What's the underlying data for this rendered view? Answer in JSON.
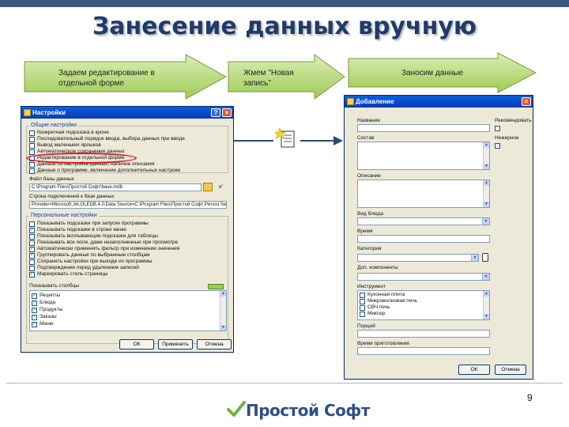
{
  "slide": {
    "title": "Занесение данных вручную",
    "page_number": "9"
  },
  "steps": [
    {
      "text": "Задаем редактирование в отдельной форме"
    },
    {
      "text": "Жмем \"Новая запись\""
    },
    {
      "text": "Заносим данные"
    }
  ],
  "settings_window": {
    "title": "Настройки",
    "general_group": "Общие настройки",
    "general_items": [
      {
        "label": "Конкретная подсказка в кроне",
        "checked": false
      },
      {
        "label": "Последовательный порядок ввода, выбора данных при вводе",
        "checked": false
      },
      {
        "label": "Вывод маленьких ярлыков",
        "checked": false
      },
      {
        "label": "Автоматическое сохранение данных",
        "checked": false
      },
      {
        "label": "Редактирование в отдельной форме",
        "checked": false
      },
      {
        "label": "Данные по настройке данных, наличие описания",
        "checked": false
      },
      {
        "label": "Данные о программе, включение дополнительных настроек",
        "checked": false
      }
    ],
    "file_label": "Файл базы данных",
    "file_value": "C:\\Program Files\\Простой Софт\\base.mdb",
    "conn_label": "Строка подключения к базе данных",
    "conn_value": "Provider=Microsoft.Jet.OLEDB.4.0;Data Source=C:\\Program Files\\Простой Софт;Persist Security Info=False",
    "personal_group": "Персональные настройки",
    "personal_items": [
      {
        "label": "Показывать подсказки при запуске программы",
        "checked": false
      },
      {
        "label": "Показывать подсказки в строке меню",
        "checked": true
      },
      {
        "label": "Показывать всплывающие подсказки для таблицы",
        "checked": false
      },
      {
        "label": "Показывать все поля, даже незаполненные при просмотре",
        "checked": false
      },
      {
        "label": "Автоматически применять фильтр при изменении значения",
        "checked": true
      },
      {
        "label": "Группировать данные по выбранным столбцам",
        "checked": true
      },
      {
        "label": "Сохранять настройки при выходе из программы",
        "checked": false
      },
      {
        "label": "Подтверждение перед удалением записей",
        "checked": false
      },
      {
        "label": "Маркировать стиль страницы",
        "checked": true
      }
    ],
    "list_label": "Показывать столбцы",
    "list_items": [
      {
        "label": "Рецепты",
        "checked": true
      },
      {
        "label": "Блюда",
        "checked": true
      },
      {
        "label": "Продукты",
        "checked": true
      },
      {
        "label": "Заказы",
        "checked": true
      },
      {
        "label": "Меню",
        "checked": true
      }
    ],
    "ok_label": "ОК",
    "apply_label": "Применить",
    "cancel_label": "Отмена"
  },
  "new_record_icon": "new-record-icon",
  "add_window": {
    "title": "Добавление",
    "name_label": "Название",
    "recommend_label": "Рекомендовать",
    "composition_label": "Состав",
    "nonfat_label": "Нежирное",
    "description_label": "Описание",
    "base_label": "Вид блюда",
    "time_label": "Время",
    "category_label": "Категория",
    "extra_label": "Доп. компоненты",
    "tools_label": "Инструмент",
    "tools_items": [
      {
        "label": "Кухонная плита",
        "checked": false
      },
      {
        "label": "Микроволновая печь",
        "checked": false
      },
      {
        "label": "СВЧ печь",
        "checked": false
      },
      {
        "label": "Миксер",
        "checked": false
      }
    ],
    "portion_label": "Порций",
    "cook_time_label": "Время приготовления",
    "ok_label": "ОК",
    "cancel_label": "Отмена"
  },
  "logo": {
    "text": "Простой Софт"
  },
  "colors": {
    "title": "#1f3b6a",
    "arrow_fill": "#a3cf5a",
    "highlight_ring": "#e4161b",
    "connector": "#2b4a78",
    "check": "#1a8a1a"
  }
}
